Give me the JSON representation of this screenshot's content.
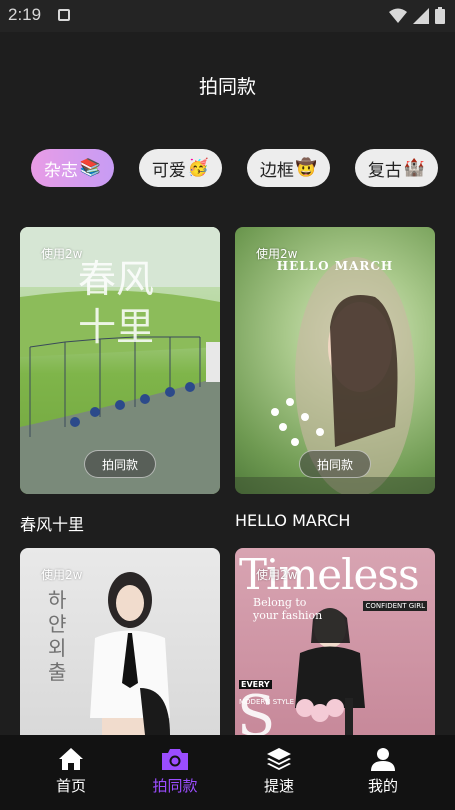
{
  "status": {
    "time": "2:19"
  },
  "header": {
    "title": "拍同款"
  },
  "chips": [
    {
      "label": "杂志",
      "emoji": "📚",
      "active": true
    },
    {
      "label": "可爱",
      "emoji": "🥳",
      "active": false
    },
    {
      "label": "边框",
      "emoji": "🤠",
      "active": false
    },
    {
      "label": "复古",
      "emoji": "🏰",
      "active": false
    }
  ],
  "cards": [
    {
      "uses": "使用2w",
      "button": "拍同款",
      "title": "春风十里",
      "art_text": "春风十里"
    },
    {
      "uses": "使用2w",
      "button": "拍同款",
      "title": "HELLO MARCH",
      "art_text": "HELLO MARCH"
    },
    {
      "uses": "使用2w",
      "art_text": "하얀 외출"
    },
    {
      "uses": "使用2w",
      "art_text": "Timeless",
      "art_sub": "Belong to your fashion",
      "art_tag": "EVERY",
      "art_tag2": "MODERN STYLE",
      "art_brand": "CONFIDENT GIRL"
    }
  ],
  "nav": [
    {
      "label": "首页",
      "icon": "home-icon",
      "active": false
    },
    {
      "label": "拍同款",
      "icon": "camera-icon",
      "active": true
    },
    {
      "label": "提速",
      "icon": "layers-icon",
      "active": false
    },
    {
      "label": "我的",
      "icon": "user-icon",
      "active": false
    }
  ],
  "colors": {
    "accent": "#9b4dff",
    "background": "#1e1e1e",
    "nav_bg": "#121212"
  }
}
